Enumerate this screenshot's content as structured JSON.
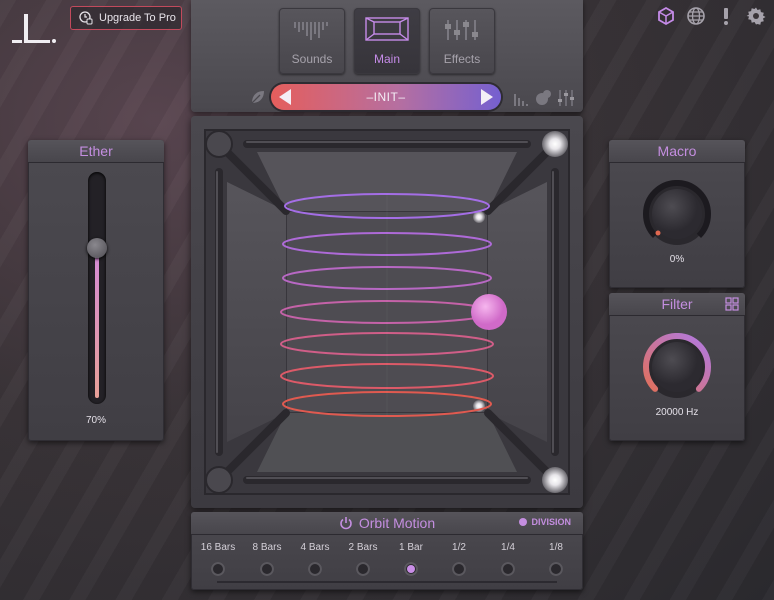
{
  "header": {
    "logo_text": "_L.",
    "upgrade_label": "Upgrade To Pro"
  },
  "top_icons": [
    "cube-icon",
    "globe-icon",
    "exclamation-icon",
    "gear-icon"
  ],
  "nav": {
    "tabs": [
      {
        "label": "Sounds",
        "icon": "waveform-icon",
        "active": false
      },
      {
        "label": "Main",
        "icon": "cube-frame-icon",
        "active": true
      },
      {
        "label": "Effects",
        "icon": "sliders-icon",
        "active": false
      }
    ],
    "preset_name": "–INIT–"
  },
  "ether": {
    "title": "Ether",
    "value_label": "70%",
    "value": 0.7
  },
  "macro": {
    "title": "Macro",
    "value_label": "0%",
    "value": 0.0
  },
  "filter": {
    "title": "Filter",
    "value_label": "20000 Hz",
    "value": 1.0
  },
  "orbit": {
    "title": "Orbit Motion",
    "division_label": "DIVISION",
    "divisions": [
      "16 Bars",
      "8 Bars",
      "4 Bars",
      "2 Bars",
      "1 Bar",
      "1/2",
      "1/4",
      "1/8"
    ],
    "selected_index": 4
  },
  "colors": {
    "accent": "#c48ee0",
    "preset_left": "#e55e5c",
    "preset_right": "#7560d0",
    "ball": "#e07ed0"
  }
}
